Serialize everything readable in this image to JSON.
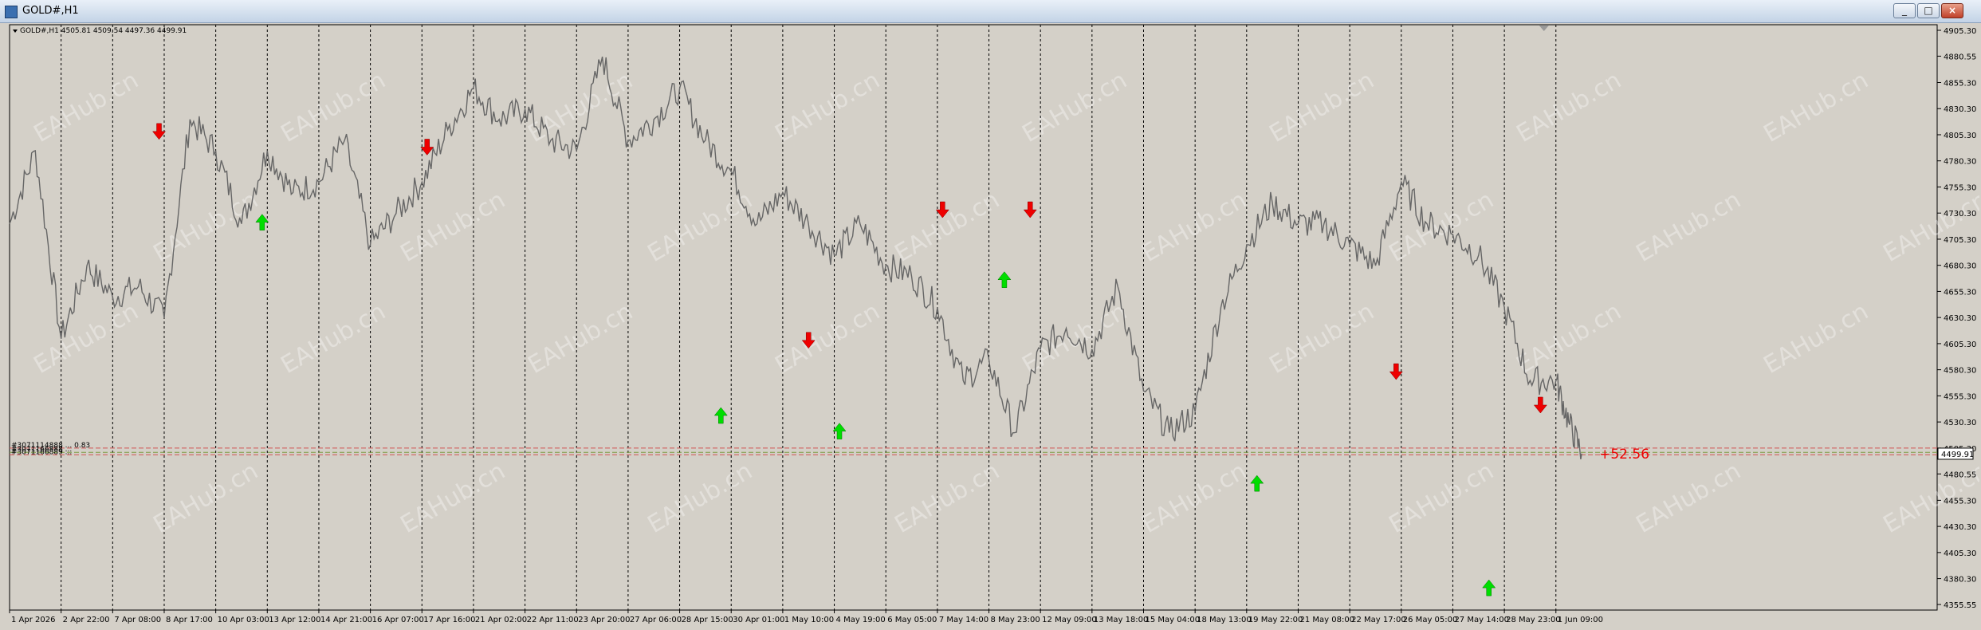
{
  "window": {
    "title": "GOLD#,H1",
    "buttons": {
      "minimize": "_",
      "maximize": "□",
      "close": "×"
    }
  },
  "header": {
    "info": "GOLD#,H1  4505.81 4509.54 4497.36 4499.91"
  },
  "colors": {
    "background": "#d4d0c8",
    "line": "#666666",
    "up_arrow": "#00dd00",
    "down_arrow": "#ee0000",
    "price_label_bg": "#ffffff"
  },
  "annotations": {
    "diff_label": "+52.56",
    "level_labels": [
      "#3071114888 ... 0.83",
      "#3071166888 ...",
      "#3071166889 ..."
    ]
  },
  "chart_data": {
    "type": "line",
    "title": "GOLD#,H1",
    "ylim": [
      4355.55,
      4905.3
    ],
    "current_price": "4499.91",
    "y_ticks": [
      "4905.30",
      "4880.55",
      "4855.30",
      "4830.30",
      "4805.30",
      "4780.30",
      "4755.30",
      "4730.30",
      "4705.30",
      "4680.30",
      "4655.30",
      "4630.30",
      "4605.30",
      "4580.30",
      "4555.30",
      "4530.30",
      "4505.30",
      "4480.55",
      "4455.30",
      "4430.30",
      "4405.30",
      "4380.30",
      "4355.55"
    ],
    "x_ticks": [
      "1 Apr 2026",
      "2 Apr 22:00",
      "7 Apr 08:00",
      "8 Apr 17:00",
      "10 Apr 03:00",
      "13 Apr 12:00",
      "14 Apr 21:00",
      "16 Apr 07:00",
      "17 Apr 16:00",
      "21 Apr 02:00",
      "22 Apr 11:00",
      "23 Apr 20:00",
      "27 Apr 06:00",
      "28 Apr 15:00",
      "30 Apr 01:00",
      "1 May 10:00",
      "4 May 19:00",
      "6 May 05:00",
      "7 May 14:00",
      "8 May 23:00",
      "12 May 09:00",
      "13 May 18:00",
      "15 May 04:00",
      "18 May 13:00",
      "19 May 22:00",
      "21 May 08:00",
      "22 May 17:00",
      "26 May 05:00",
      "27 May 14:00",
      "28 May 23:00",
      "1 Jun 09:00"
    ],
    "x": [
      0,
      0.5,
      1,
      1.5,
      2,
      2.5,
      3,
      3.5,
      4,
      4.5,
      5,
      5.5,
      6,
      6.5,
      7,
      7.5,
      8,
      8.5,
      9,
      9.5,
      10,
      10.5,
      11,
      11.5,
      12,
      12.5,
      13,
      13.5,
      14,
      14.5,
      15,
      15.5,
      16,
      16.5,
      17,
      17.5,
      18,
      18.5,
      19,
      19.5,
      20,
      20.5,
      21,
      21.5,
      22,
      22.5,
      23,
      23.5,
      24,
      24.5,
      25,
      25.5,
      26,
      26.5,
      27,
      27.5,
      28,
      28.5,
      29,
      29.5,
      30,
      30.25,
      30.5
    ],
    "values": [
      4720,
      4790,
      4610,
      4680,
      4650,
      4660,
      4630,
      4820,
      4790,
      4720,
      4790,
      4750,
      4760,
      4800,
      4700,
      4730,
      4760,
      4810,
      4850,
      4820,
      4830,
      4800,
      4790,
      4880,
      4800,
      4820,
      4850,
      4800,
      4770,
      4720,
      4750,
      4720,
      4690,
      4720,
      4680,
      4670,
      4640,
      4570,
      4590,
      4520,
      4600,
      4620,
      4600,
      4660,
      4560,
      4520,
      4540,
      4640,
      4700,
      4740,
      4720,
      4720,
      4700,
      4680,
      4760,
      4720,
      4710,
      4690,
      4640,
      4570,
      4570,
      4530,
      4500
    ],
    "signals": [
      {
        "type": "sell",
        "x": 2.9,
        "price": 4810
      },
      {
        "type": "buy",
        "x": 4.9,
        "price": 4720
      },
      {
        "type": "sell",
        "x": 8.1,
        "price": 4795
      },
      {
        "type": "buy",
        "x": 13.8,
        "price": 4535
      },
      {
        "type": "sell",
        "x": 15.5,
        "price": 4610
      },
      {
        "type": "buy",
        "x": 16.1,
        "price": 4520
      },
      {
        "type": "sell",
        "x": 18.1,
        "price": 4735
      },
      {
        "type": "sell",
        "x": 19.8,
        "price": 4735
      },
      {
        "type": "buy",
        "x": 19.3,
        "price": 4665
      },
      {
        "type": "buy",
        "x": 24.2,
        "price": 4470
      },
      {
        "type": "sell",
        "x": 26.9,
        "price": 4580
      },
      {
        "type": "buy",
        "x": 28.7,
        "price": 4370
      },
      {
        "type": "sell",
        "x": 29.7,
        "price": 4548
      }
    ],
    "levels": [
      4505.3,
      4501.2,
      4498.9
    ],
    "watermark": "EAHub.cn"
  }
}
